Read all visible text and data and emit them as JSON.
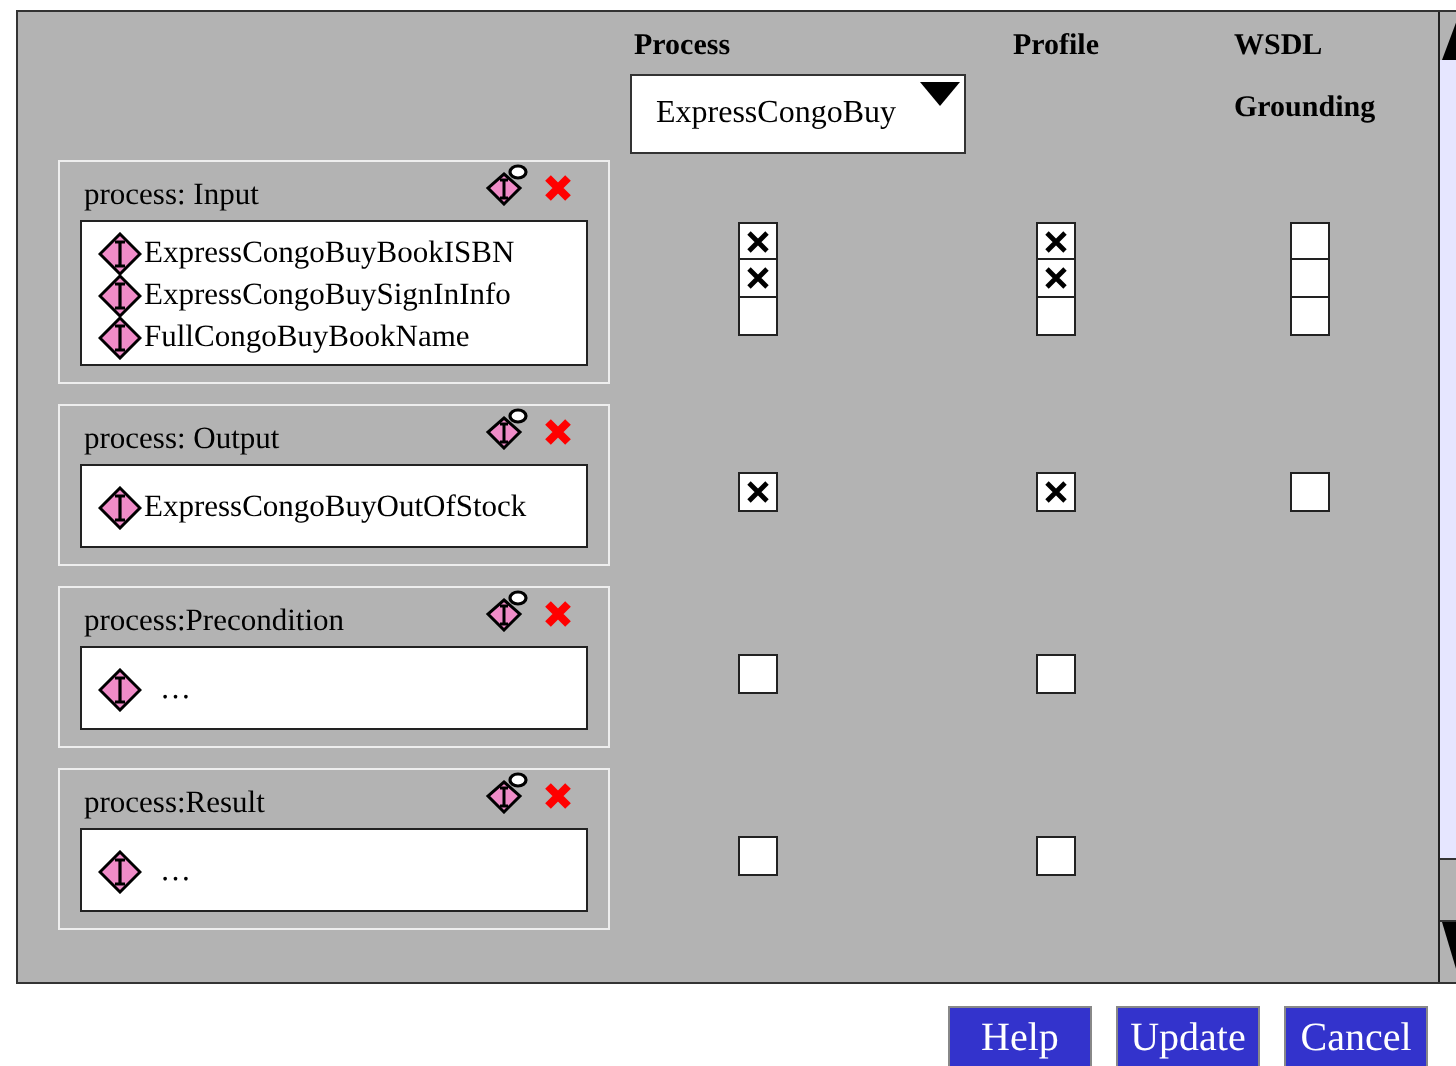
{
  "headers": {
    "process": "Process",
    "profile": "Profile",
    "wsdl_line_1": "WSDL",
    "wsdl_line_2": "Grounding"
  },
  "process_dropdown": {
    "value": "ExpressCongoBuy"
  },
  "sections": [
    {
      "title": "process: Input",
      "entries": [
        "ExpressCongoBuyBookISBN",
        "ExpressCongoBuySignInInfo",
        "FullCongoBuyBookName"
      ],
      "process": [
        {
          "checked": true
        },
        {
          "checked": true
        },
        {
          "checked": false
        }
      ],
      "profile": [
        {
          "checked": true
        },
        {
          "checked": true
        },
        {
          "checked": false
        }
      ],
      "wsdl": [
        {
          "checked": false
        },
        {
          "checked": false
        },
        {
          "checked": false
        }
      ]
    },
    {
      "title": "process: Output",
      "entries": [
        "ExpressCongoBuyOutOfStock"
      ],
      "process": [
        {
          "checked": true
        }
      ],
      "profile": [
        {
          "checked": true
        }
      ],
      "wsdl": [
        {
          "checked": false
        }
      ]
    },
    {
      "title": "process:Precondition",
      "entries": [
        "…"
      ],
      "process": [
        {
          "checked": false
        }
      ],
      "profile": [
        {
          "checked": false
        }
      ]
    },
    {
      "title": "process:Result",
      "entries": [
        "…"
      ],
      "process": [
        {
          "checked": false
        }
      ],
      "profile": [
        {
          "checked": false
        }
      ]
    }
  ],
  "buttons": [
    "Help",
    "Update",
    "Cancel"
  ]
}
